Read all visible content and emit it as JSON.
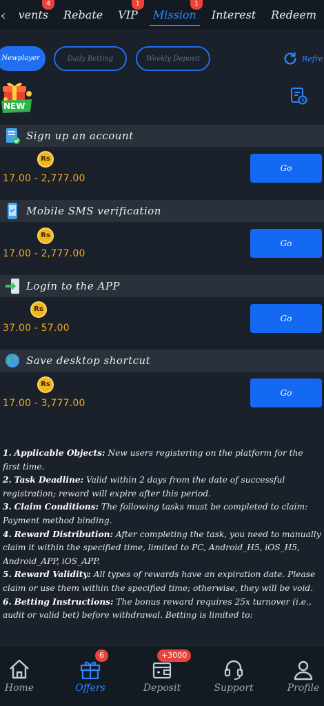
{
  "top_tabs": [
    {
      "label": "vents",
      "badge": "4",
      "active": false
    },
    {
      "label": "Rebate",
      "badge": "",
      "active": false
    },
    {
      "label": "VIP",
      "badge": "1",
      "active": false
    },
    {
      "label": "Mission",
      "badge": "1",
      "active": true
    },
    {
      "label": "Interest",
      "badge": "",
      "active": false
    },
    {
      "label": "Redeem",
      "badge": "",
      "active": false
    }
  ],
  "chips": [
    {
      "label": "Newplayer",
      "active": true
    },
    {
      "label": "Daily Betting",
      "active": false
    },
    {
      "label": "Weekly Deposit",
      "active": false
    }
  ],
  "refresh_label": "Refre",
  "new_badge": "NEW",
  "currency_symbol": "Rs",
  "tasks": [
    {
      "title": "Sign up an account",
      "icon": "signup-icon",
      "reward": "17.00 - 2,777.00",
      "button": "Go"
    },
    {
      "title": "Mobile SMS verification",
      "icon": "phone-sms-icon",
      "reward": "17.00 - 2,777.00",
      "button": "Go"
    },
    {
      "title": "Login to the APP",
      "icon": "login-icon",
      "reward": "37.00 - 57.00",
      "button": "Go"
    },
    {
      "title": "Save desktop shortcut",
      "icon": "globe-icon",
      "reward": "17.00 - 3,777.00",
      "button": "Go"
    }
  ],
  "rules": [
    {
      "num": "1.",
      "label": "Applicable Objects:",
      "text": " New users registering on the platform for the first time."
    },
    {
      "num": "2.",
      "label": "Task Deadline:",
      "text": " Valid within 2 days from the date of successful registration; reward will expire after this period."
    },
    {
      "num": "3.",
      "label": "Claim Conditions:",
      "text": " The following tasks must be completed to claim: Payment method binding."
    },
    {
      "num": "4.",
      "label": "Reward Distribution:",
      "text": " After completing the task, you need to manually claim it within the specified time, limited to PC, Android_H5, iOS_H5, Android_APP, iOS_APP."
    },
    {
      "num": "5.",
      "label": "Reward Validity:",
      "text": " All types of rewards have an expiration date. Please claim or use them within the specified time; otherwise, they will be void."
    },
    {
      "num": "6.",
      "label": "Betting Instructions:",
      "text": " The bonus reward requires 25x turnover (i.e., audit or valid bet) before withdrawal. Betting is limited to:"
    }
  ],
  "bottom_nav": [
    {
      "label": "Home",
      "icon": "home-icon",
      "badge": "",
      "active": false
    },
    {
      "label": "Offers",
      "icon": "gift-icon",
      "badge": "6",
      "active": true
    },
    {
      "label": "Deposit",
      "icon": "wallet-icon",
      "badge": "+3000",
      "active": false
    },
    {
      "label": "Support",
      "icon": "headset-icon",
      "badge": "",
      "active": false
    },
    {
      "label": "Profile",
      "icon": "user-icon",
      "badge": "",
      "active": false
    }
  ],
  "colors": {
    "accent": "#1f6ff0",
    "reward": "#f5a623",
    "badge": "#e9433b",
    "background": "#1b212b"
  }
}
